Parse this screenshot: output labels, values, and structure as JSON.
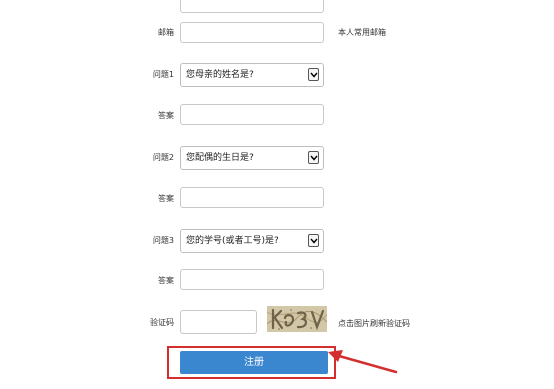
{
  "fields": {
    "email_label": "邮箱",
    "email_hint": "本人常用邮箱",
    "q1_label": "问题1",
    "q1_value": "您母亲的姓名是?",
    "a1_label": "答案",
    "q2_label": "问题2",
    "q2_value": "您配偶的生日是?",
    "a2_label": "答案",
    "q3_label": "问题3",
    "q3_value": "您的学号(或者工号)是?",
    "a3_label": "答案",
    "captcha_label": "验证码",
    "captcha_hint": "点击图片刷新验证码"
  },
  "submit_label": "注册",
  "colors": {
    "submit_bg": "#3a87cf",
    "highlight": "#d32f2f"
  }
}
